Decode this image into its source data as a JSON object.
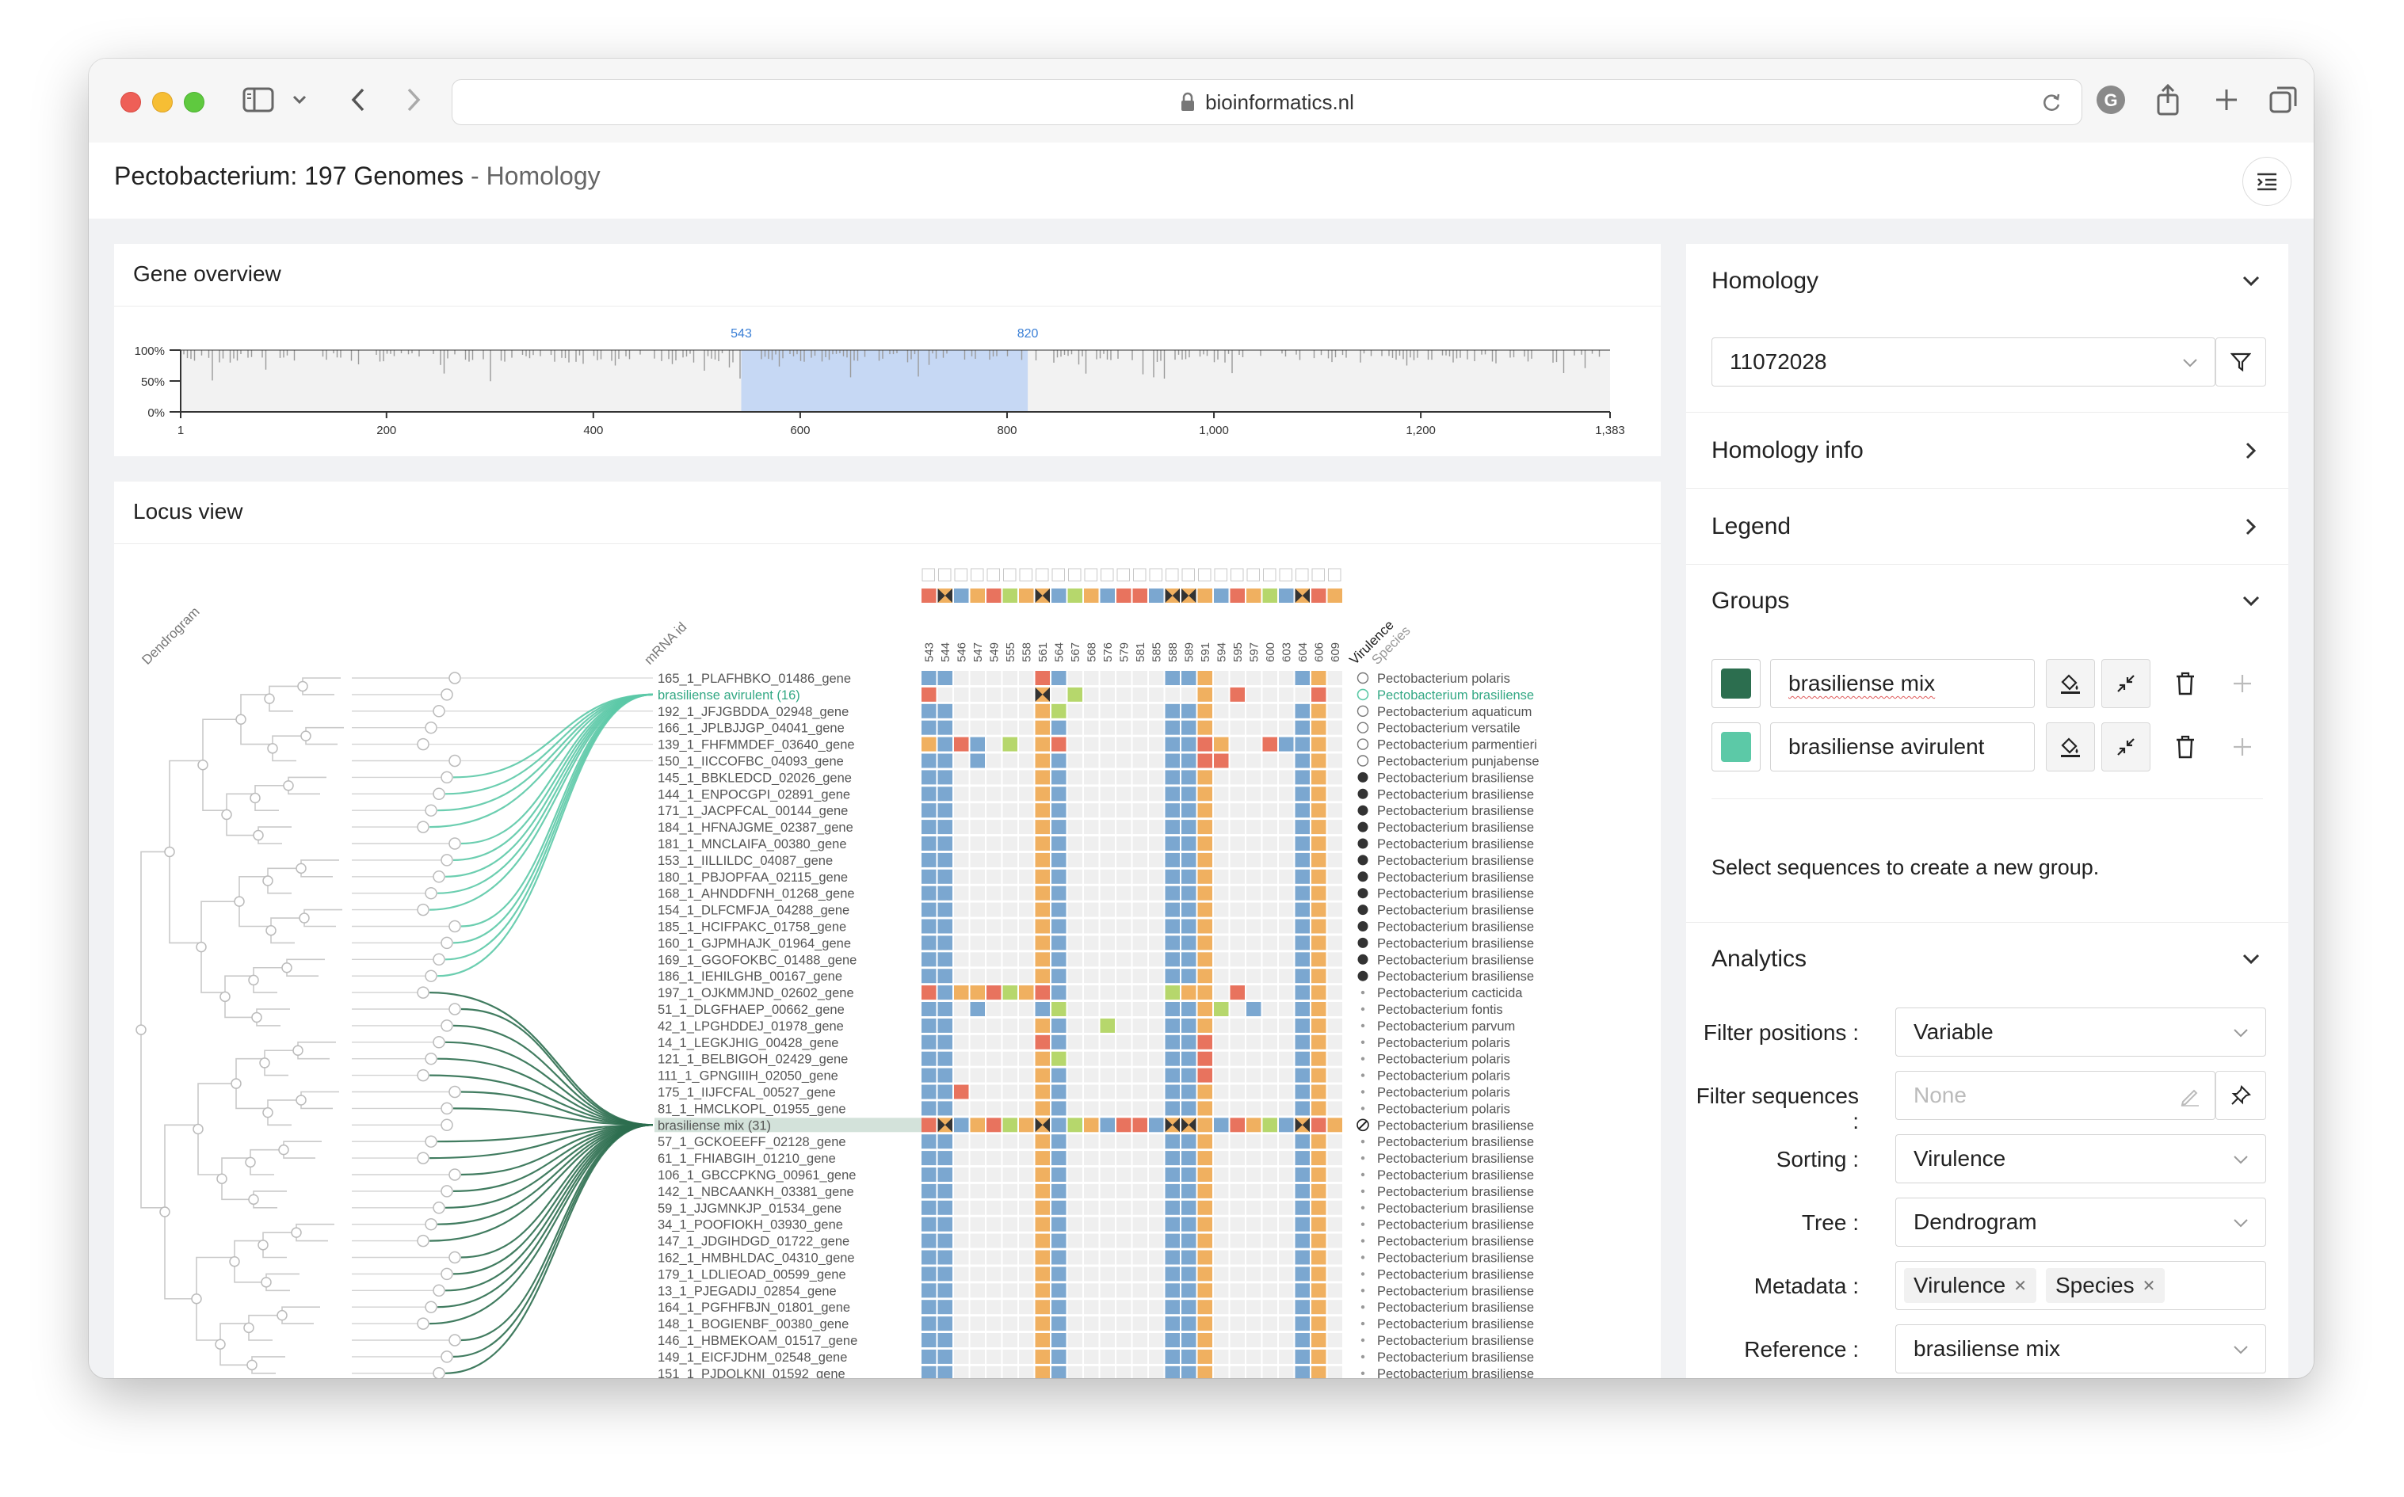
{
  "browser": {
    "url": "bioinformatics.nl"
  },
  "app": {
    "title": "Pectobacterium: 197 Genomes",
    "separator": " - ",
    "subtitle": "Homology"
  },
  "gene_overview": {
    "title": "Gene overview",
    "yticks": [
      "100%",
      "50%",
      "0%"
    ],
    "xticks": [
      "1",
      "200",
      "400",
      "600",
      "800",
      "1,000",
      "1,200",
      "1,383"
    ],
    "selection_start": "543",
    "selection_end": "820",
    "x_min": 1,
    "x_max": 1383,
    "sel_min": 543,
    "sel_max": 820
  },
  "locus": {
    "title": "Locus view",
    "dendrogram_label": "Dendrogram",
    "mrna_label": "mRNA id",
    "virulence_label": "Virulence",
    "species_label": "Species",
    "positions": [
      "543",
      "544",
      "546",
      "547",
      "549",
      "555",
      "558",
      "561",
      "564",
      "567",
      "568",
      "576",
      "579",
      "581",
      "585",
      "588",
      "589",
      "591",
      "594",
      "595",
      "597",
      "600",
      "603",
      "604",
      "606",
      "609"
    ],
    "rows": [
      {
        "id": "165_1_PLAFHBKO_01486_gene",
        "species": "Pectobacterium polaris",
        "vir": "open",
        "hl": ""
      },
      {
        "id": "brasiliense avirulent (16)",
        "species": "Pectobacterium brasiliense",
        "vir": "open-green",
        "hl": "green"
      },
      {
        "id": "192_1_JFJGBDDA_02948_gene",
        "species": "Pectobacterium aquaticum",
        "vir": "open",
        "hl": ""
      },
      {
        "id": "166_1_JPLBJJGP_04041_gene",
        "species": "Pectobacterium versatile",
        "vir": "open",
        "hl": ""
      },
      {
        "id": "139_1_FHFMMDEF_03640_gene",
        "species": "Pectobacterium parmentieri",
        "vir": "open",
        "hl": ""
      },
      {
        "id": "150_1_IICCOFBC_04093_gene",
        "species": "Pectobacterium punjabense",
        "vir": "open",
        "hl": ""
      },
      {
        "id": "145_1_BBKLEDCD_02026_gene",
        "species": "Pectobacterium brasiliense",
        "vir": "filled",
        "hl": ""
      },
      {
        "id": "144_1_ENPOCGPI_02891_gene",
        "species": "Pectobacterium brasiliense",
        "vir": "filled",
        "hl": ""
      },
      {
        "id": "171_1_JACPFCAL_00144_gene",
        "species": "Pectobacterium brasiliense",
        "vir": "filled",
        "hl": ""
      },
      {
        "id": "184_1_HFNAJGME_02387_gene",
        "species": "Pectobacterium brasiliense",
        "vir": "filled",
        "hl": ""
      },
      {
        "id": "181_1_MNCLAIFA_00380_gene",
        "species": "Pectobacterium brasiliense",
        "vir": "filled",
        "hl": ""
      },
      {
        "id": "153_1_IILLILDC_04087_gene",
        "species": "Pectobacterium brasiliense",
        "vir": "filled",
        "hl": ""
      },
      {
        "id": "180_1_PBJOPFAA_02115_gene",
        "species": "Pectobacterium brasiliense",
        "vir": "filled",
        "hl": ""
      },
      {
        "id": "168_1_AHNDDFNH_01268_gene",
        "species": "Pectobacterium brasiliense",
        "vir": "filled",
        "hl": ""
      },
      {
        "id": "154_1_DLFCMFJA_04288_gene",
        "species": "Pectobacterium brasiliense",
        "vir": "filled",
        "hl": ""
      },
      {
        "id": "185_1_HCIFPAKC_01758_gene",
        "species": "Pectobacterium brasiliense",
        "vir": "filled",
        "hl": ""
      },
      {
        "id": "160_1_GJPMHAJK_01964_gene",
        "species": "Pectobacterium brasiliense",
        "vir": "filled",
        "hl": ""
      },
      {
        "id": "169_1_GGOFOKBC_01488_gene",
        "species": "Pectobacterium brasiliense",
        "vir": "filled",
        "hl": ""
      },
      {
        "id": "186_1_IEHILGHB_00167_gene",
        "species": "Pectobacterium brasiliense",
        "vir": "filled",
        "hl": ""
      },
      {
        "id": "197_1_OJKMMJND_02602_gene",
        "species": "Pectobacterium cacticida",
        "vir": "dot",
        "hl": ""
      },
      {
        "id": "51_1_DLGFHAEP_00662_gene",
        "species": "Pectobacterium fontis",
        "vir": "dot",
        "hl": ""
      },
      {
        "id": "42_1_LPGHDDEJ_01978_gene",
        "species": "Pectobacterium parvum",
        "vir": "dot",
        "hl": ""
      },
      {
        "id": "14_1_LEGKJHIG_00428_gene",
        "species": "Pectobacterium polaris",
        "vir": "dot",
        "hl": ""
      },
      {
        "id": "121_1_BELBIGOH_02429_gene",
        "species": "Pectobacterium polaris",
        "vir": "dot",
        "hl": ""
      },
      {
        "id": "111_1_GPNGIIIH_02050_gene",
        "species": "Pectobacterium polaris",
        "vir": "dot",
        "hl": ""
      },
      {
        "id": "175_1_IIJFCFAL_00527_gene",
        "species": "Pectobacterium polaris",
        "vir": "dot",
        "hl": ""
      },
      {
        "id": "81_1_HMCLKOPL_01955_gene",
        "species": "Pectobacterium polaris",
        "vir": "dot",
        "hl": ""
      },
      {
        "id": "brasiliense mix (31)",
        "species": "Pectobacterium brasiliense",
        "vir": "hatched",
        "hl": "dark"
      },
      {
        "id": "57_1_GCKOEEFF_02128_gene",
        "species": "Pectobacterium brasiliense",
        "vir": "dot",
        "hl": ""
      },
      {
        "id": "61_1_FHIABGIH_01210_gene",
        "species": "Pectobacterium brasiliense",
        "vir": "dot",
        "hl": ""
      },
      {
        "id": "106_1_GBCCPKNG_00961_gene",
        "species": "Pectobacterium brasiliense",
        "vir": "dot",
        "hl": ""
      },
      {
        "id": "142_1_NBCAANKH_03381_gene",
        "species": "Pectobacterium brasiliense",
        "vir": "dot",
        "hl": ""
      },
      {
        "id": "59_1_JJGMNKJP_01534_gene",
        "species": "Pectobacterium brasiliense",
        "vir": "dot",
        "hl": ""
      },
      {
        "id": "34_1_POOFIOKH_03930_gene",
        "species": "Pectobacterium brasiliense",
        "vir": "dot",
        "hl": ""
      },
      {
        "id": "147_1_JDGIHDGD_01722_gene",
        "species": "Pectobacterium brasiliense",
        "vir": "dot",
        "hl": ""
      },
      {
        "id": "162_1_HMBHLDAC_04310_gene",
        "species": "Pectobacterium brasiliense",
        "vir": "dot",
        "hl": ""
      },
      {
        "id": "179_1_LDLIEOAD_00599_gene",
        "species": "Pectobacterium brasiliense",
        "vir": "dot",
        "hl": ""
      },
      {
        "id": "13_1_PJEGADIJ_02854_gene",
        "species": "Pectobacterium brasiliense",
        "vir": "dot",
        "hl": ""
      },
      {
        "id": "164_1_PGFHFBJN_01801_gene",
        "species": "Pectobacterium brasiliense",
        "vir": "dot",
        "hl": ""
      },
      {
        "id": "148_1_BOGIENBF_00380_gene",
        "species": "Pectobacterium brasiliense",
        "vir": "dot",
        "hl": ""
      },
      {
        "id": "146_1_HBMEKOAM_01517_gene",
        "species": "Pectobacterium brasiliense",
        "vir": "dot",
        "hl": ""
      },
      {
        "id": "149_1_EICFJDHM_02548_gene",
        "species": "Pectobacterium brasiliense",
        "vir": "dot",
        "hl": ""
      },
      {
        "id": "151_1_PJDOLKNI_01592_gene",
        "species": "Pectobacterium brasiliense",
        "vir": "dot",
        "hl": ""
      }
    ]
  },
  "panel": {
    "homology": {
      "title": "Homology",
      "value": "11072028"
    },
    "homology_info": {
      "title": "Homology info"
    },
    "legend": {
      "title": "Legend"
    },
    "groups": {
      "title": "Groups",
      "items": [
        {
          "name": "brasiliense mix",
          "color": "#2c6e4f"
        },
        {
          "name": "brasiliense avirulent",
          "color": "#5cc9a7"
        }
      ],
      "hint": "Select sequences to create a new group."
    },
    "analytics": {
      "title": "Analytics",
      "filter_positions_label": "Filter positions",
      "filter_positions_value": "Variable",
      "filter_sequences_label": "Filter sequences",
      "filter_sequences_placeholder": "None",
      "sorting_label": "Sorting",
      "sorting_value": "Virulence",
      "tree_label": "Tree",
      "tree_value": "Dendrogram",
      "metadata_label": "Metadata",
      "metadata_tags": [
        "Virulence",
        "Species"
      ],
      "reference_label": "Reference",
      "reference_value": "brasiliense mix"
    }
  },
  "colors": {
    "nuc_a": "#5fa85a",
    "nuc_c": "#7ba7d0",
    "nuc_g": "#f0b060",
    "nuc_t": "#e8735e",
    "lime": "#b6d76c",
    "gap": "#efefef",
    "group_dark": "#2c6e4f",
    "group_light": "#5cc9a7",
    "selection": "#c6d8f4"
  }
}
